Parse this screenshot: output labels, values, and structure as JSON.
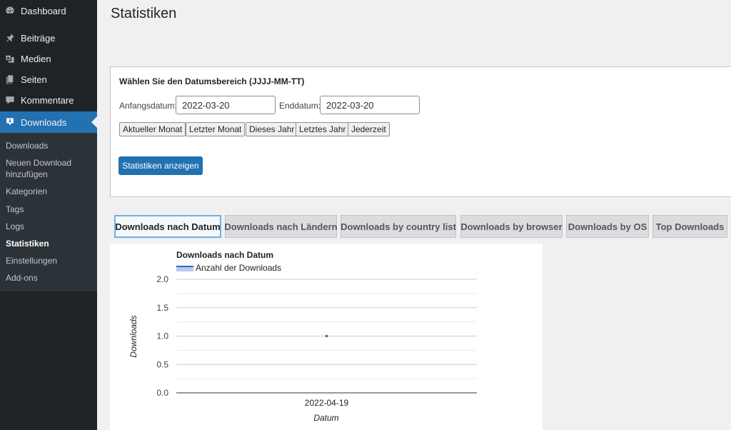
{
  "sidebar": {
    "items": [
      {
        "label": "Dashboard",
        "icon": "dashboard-icon"
      },
      {
        "label": "Beiträge",
        "icon": "pin-icon"
      },
      {
        "label": "Medien",
        "icon": "media-icon"
      },
      {
        "label": "Seiten",
        "icon": "pages-icon"
      },
      {
        "label": "Kommentare",
        "icon": "comments-icon"
      },
      {
        "label": "Downloads",
        "icon": "download-icon",
        "active": true
      }
    ],
    "submenu": [
      {
        "label": "Downloads"
      },
      {
        "label": "Neuen Download hinzufügen"
      },
      {
        "label": "Kategorien"
      },
      {
        "label": "Tags"
      },
      {
        "label": "Logs"
      },
      {
        "label": "Statistiken",
        "current": true
      },
      {
        "label": "Einstellungen"
      },
      {
        "label": "Add-ons"
      }
    ]
  },
  "page": {
    "title": "Statistiken"
  },
  "date_range": {
    "heading": "Wählen Sie den Datumsbereich (JJJJ-MM-TT)",
    "start_label": "Anfangsdatum:",
    "start_value": "2022-03-20",
    "end_label": "Enddatum:",
    "end_value": "2022-03-20",
    "presets": [
      "Aktueller Monat",
      "Letzter Monat",
      "Dieses Jahr",
      "Letztes Jahr",
      "Jederzeit"
    ],
    "submit_label": "Statistiken anzeigen"
  },
  "tabs": [
    {
      "label": "Downloads nach Datum",
      "active": true
    },
    {
      "label": "Downloads nach Ländern"
    },
    {
      "label": "Downloads by country list"
    },
    {
      "label": "Downloads by browser"
    },
    {
      "label": "Downloads by OS"
    },
    {
      "label": "Top Downloads"
    }
  ],
  "colors": {
    "accent": "#2271b1",
    "sidebar_bg": "#1d2327",
    "series": "#3366cc"
  },
  "chart_data": {
    "type": "line",
    "title": "Downloads nach Datum",
    "xlabel": "Datum",
    "ylabel": "Downloads",
    "categories": [
      "2022-04-19"
    ],
    "series": [
      {
        "name": "Anzahl der Downloads",
        "values": [
          1
        ]
      }
    ],
    "ylim": [
      0,
      2
    ],
    "yticks": [
      "0.0",
      "0.5",
      "1.0",
      "1.5",
      "2.0"
    ],
    "grid": true,
    "legend": "top-left"
  }
}
